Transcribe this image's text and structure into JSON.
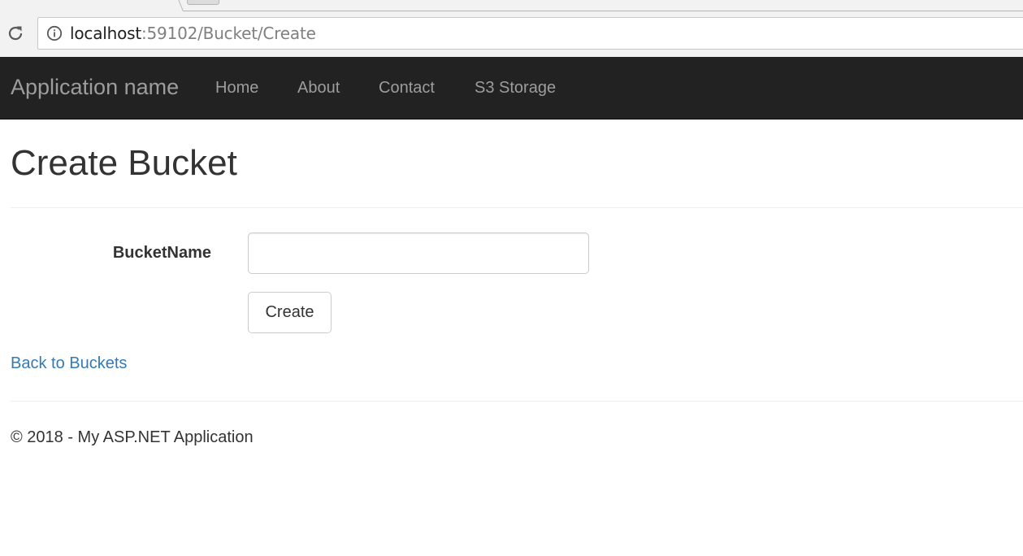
{
  "browser": {
    "url_host": "localhost",
    "url_path": ":59102/Bucket/Create"
  },
  "navbar": {
    "brand": "Application name",
    "links": [
      "Home",
      "About",
      "Contact",
      "S3 Storage"
    ]
  },
  "page": {
    "title": "Create Bucket",
    "form": {
      "field_label": "BucketName",
      "field_value": "",
      "submit_label": "Create"
    },
    "back_link": "Back to Buckets"
  },
  "footer": {
    "text": "© 2018 - My ASP.NET Application"
  },
  "colors": {
    "navbar_bg": "#222222",
    "nav_text": "#9d9d9d",
    "link": "#337ab7"
  },
  "icons": {
    "reload": "reload-icon",
    "site_info": "info-icon"
  }
}
